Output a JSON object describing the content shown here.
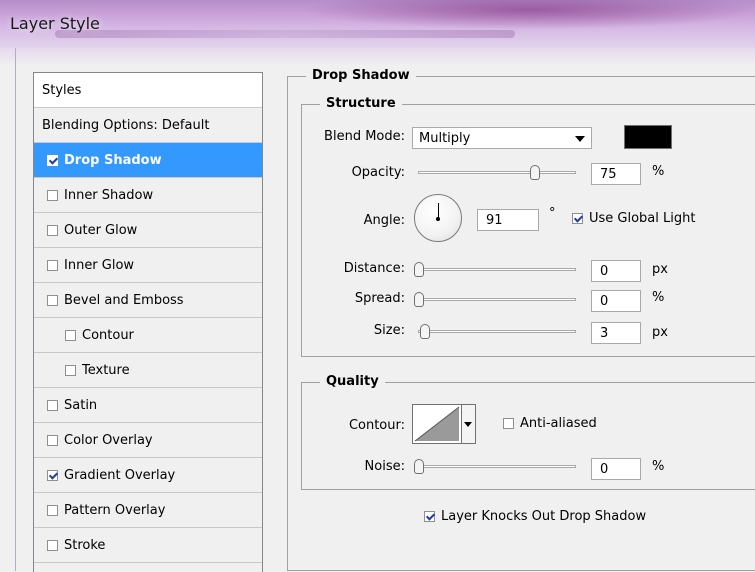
{
  "window": {
    "title": "Layer Style"
  },
  "styles_panel": {
    "header": "Styles",
    "items": [
      {
        "label": "Blending Options: Default",
        "has_checkbox": false,
        "checked": false,
        "indent": 0,
        "selected": false
      },
      {
        "label": "Drop Shadow",
        "has_checkbox": true,
        "checked": true,
        "indent": 0,
        "selected": true
      },
      {
        "label": "Inner Shadow",
        "has_checkbox": true,
        "checked": false,
        "indent": 0,
        "selected": false
      },
      {
        "label": "Outer Glow",
        "has_checkbox": true,
        "checked": false,
        "indent": 0,
        "selected": false
      },
      {
        "label": "Inner Glow",
        "has_checkbox": true,
        "checked": false,
        "indent": 0,
        "selected": false
      },
      {
        "label": "Bevel and Emboss",
        "has_checkbox": true,
        "checked": false,
        "indent": 0,
        "selected": false
      },
      {
        "label": "Contour",
        "has_checkbox": true,
        "checked": false,
        "indent": 1,
        "selected": false
      },
      {
        "label": "Texture",
        "has_checkbox": true,
        "checked": false,
        "indent": 1,
        "selected": false
      },
      {
        "label": "Satin",
        "has_checkbox": true,
        "checked": false,
        "indent": 0,
        "selected": false
      },
      {
        "label": "Color Overlay",
        "has_checkbox": true,
        "checked": false,
        "indent": 0,
        "selected": false
      },
      {
        "label": "Gradient Overlay",
        "has_checkbox": true,
        "checked": true,
        "indent": 0,
        "selected": false
      },
      {
        "label": "Pattern Overlay",
        "has_checkbox": true,
        "checked": false,
        "indent": 0,
        "selected": false
      },
      {
        "label": "Stroke",
        "has_checkbox": true,
        "checked": false,
        "indent": 0,
        "selected": false
      }
    ]
  },
  "drop_shadow": {
    "title": "Drop Shadow",
    "structure": {
      "title": "Structure",
      "blend_mode": {
        "label": "Blend Mode:",
        "value": "Multiply",
        "color": "#000000"
      },
      "opacity": {
        "label": "Opacity:",
        "value": "75",
        "unit": "%",
        "slider_fraction": 0.75
      },
      "angle": {
        "label": "Angle:",
        "value": "91",
        "unit": "°",
        "use_global_light_label": "Use Global Light",
        "use_global_light": true
      },
      "distance": {
        "label": "Distance:",
        "value": "0",
        "unit": "px",
        "slider_fraction": 0
      },
      "spread": {
        "label": "Spread:",
        "value": "0",
        "unit": "%",
        "slider_fraction": 0
      },
      "size": {
        "label": "Size:",
        "value": "3",
        "unit": "px",
        "slider_fraction": 0.01
      }
    },
    "quality": {
      "title": "Quality",
      "contour": {
        "label": "Contour:",
        "anti_aliased_label": "Anti-aliased",
        "anti_aliased": false
      },
      "noise": {
        "label": "Noise:",
        "value": "0",
        "unit": "%",
        "slider_fraction": 0
      }
    },
    "knockout": {
      "label": "Layer Knocks Out Drop Shadow",
      "checked": true
    }
  }
}
